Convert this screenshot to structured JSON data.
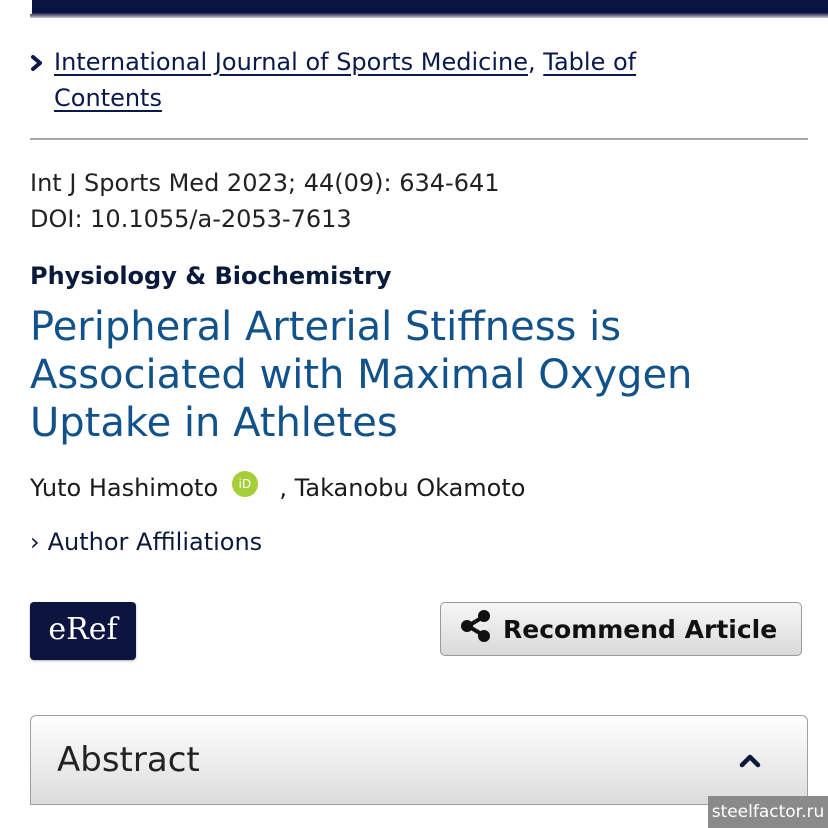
{
  "breadcrumb": {
    "journal": "International Journal of Sports Medicine",
    "separator": ",",
    "toc_line1": "Table of",
    "toc_line2": "Contents"
  },
  "citation": {
    "reference": "Int J Sports Med 2023; 44(09): 634-641",
    "doi": "DOI: 10.1055/a-2053-7613"
  },
  "article": {
    "section": "Physiology & Biochemistry",
    "title": "Peripheral Arterial Stiffness is Associated with Maximal Oxygen Uptake in Athletes",
    "author1": "Yuto Hashimoto",
    "orcid_label": "iD",
    "author2": ", Takanobu Okamoto",
    "affiliations_caret": "›",
    "affiliations": "Author Affiliations"
  },
  "actions": {
    "eref": "eRef",
    "recommend": "Recommend Article"
  },
  "abstract": {
    "label": "Abstract"
  },
  "watermark": "steelfactor.ru",
  "colors": {
    "title": "#12528a",
    "navy": "#0c1540",
    "orcid": "#a6ce39"
  },
  "icons": [
    "chevron-right-icon",
    "orcid-icon",
    "share-icon",
    "chevron-up-icon"
  ]
}
